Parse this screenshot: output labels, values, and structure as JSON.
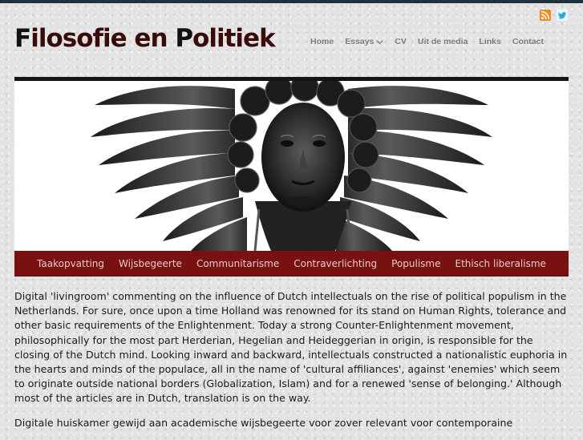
{
  "site": {
    "title_parts": [
      "F",
      "ilosofie en ",
      "P",
      "olitiek"
    ],
    "accent_color": "#3a0b0b",
    "banner_color": "#7a1111"
  },
  "social": [
    {
      "name": "rss-feed",
      "icon": "rss-icon"
    },
    {
      "name": "twitter",
      "icon": "twitter-icon"
    }
  ],
  "main_nav": [
    {
      "label": "Home"
    },
    {
      "label": "Essays",
      "has_dropdown": true
    },
    {
      "label": "CV"
    },
    {
      "label": "Uit de media"
    },
    {
      "label": "Links"
    },
    {
      "label": "Contact"
    }
  ],
  "category_nav": [
    {
      "label": "Taakopvatting"
    },
    {
      "label": "Wijsbegeerte"
    },
    {
      "label": "Communitarisme"
    },
    {
      "label": "Contraverlichting"
    },
    {
      "label": "Populisme"
    },
    {
      "label": "Ethisch liberalisme"
    }
  ],
  "content": {
    "paragraphs": [
      "Digital 'livingroom' commenting on the influence of Dutch intellectuals on the rise of political populism in the Netherlands. For sure, once upon a time Holland was renowned for its stand on Human Rights, tolerance and other basic requirements of the Enlightenment. Today a strong Counter-Enlightenment movement, philosophically for the most part Herderian, Hegelian and Heideggerian in origin, is responsible for the closing of the Dutch mind. Looking inward and backward, intellectuals constructed a nationalistic euphoria in the hearts and minds of the populace, all in the name of 'cultural affiliances', against 'enemies' which seem to originate outside national borders (Globalization, Islam) and for a renewed 'sense of belonging.' Although most of the articles are in Dutch, translation is on the way.",
      "Digitale huiskamer gewijd aan academische wijsbegeerte voor zover relevant voor contemporaine"
    ]
  }
}
